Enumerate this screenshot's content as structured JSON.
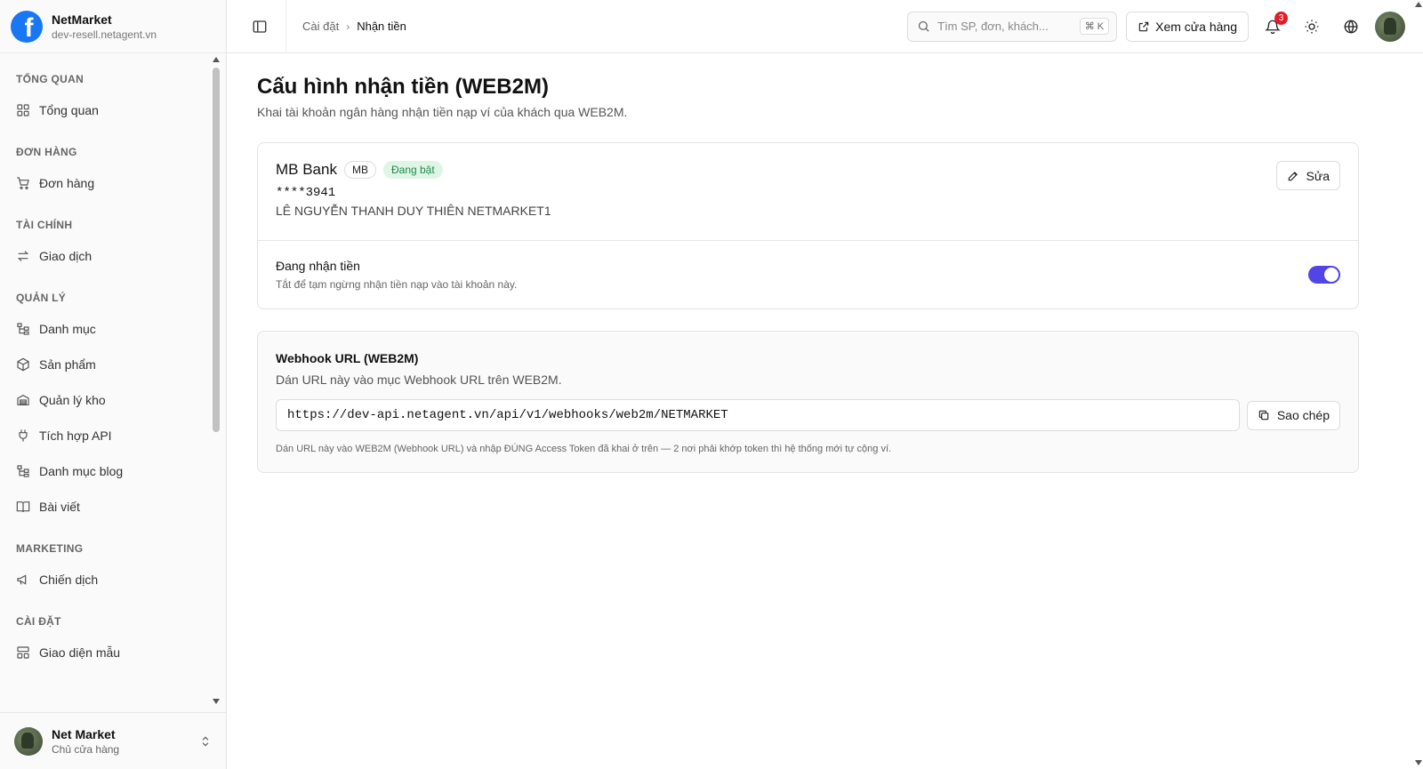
{
  "brand": {
    "name": "NetMarket",
    "domain": "dev-resell.netagent.vn",
    "logo_icon": "facebook-logo",
    "logo_glyph": "f"
  },
  "sidebar": {
    "sections": [
      {
        "title": "TỔNG QUAN",
        "items": [
          {
            "label": "Tổng quan",
            "icon": "dashboard-icon"
          }
        ]
      },
      {
        "title": "ĐƠN HÀNG",
        "items": [
          {
            "label": "Đơn hàng",
            "icon": "cart-icon"
          }
        ]
      },
      {
        "title": "TÀI CHÍNH",
        "items": [
          {
            "label": "Giao dịch",
            "icon": "transfer-icon"
          }
        ]
      },
      {
        "title": "QUẢN LÝ",
        "items": [
          {
            "label": "Danh mục",
            "icon": "category-tree-icon"
          },
          {
            "label": "Sản phẩm",
            "icon": "package-icon"
          },
          {
            "label": "Quản lý kho",
            "icon": "warehouse-icon"
          },
          {
            "label": "Tích hợp API",
            "icon": "plug-icon"
          },
          {
            "label": "Danh mục blog",
            "icon": "category-tree-icon"
          },
          {
            "label": "Bài viết",
            "icon": "book-icon"
          }
        ]
      },
      {
        "title": "MARKETING",
        "items": [
          {
            "label": "Chiến dịch",
            "icon": "megaphone-icon"
          }
        ]
      },
      {
        "title": "CÀI ĐẶT",
        "items": [
          {
            "label": "Giao diện mẫu",
            "icon": "layout-icon"
          }
        ]
      }
    ],
    "user": {
      "name": "Net Market",
      "role": "Chủ cửa hàng"
    }
  },
  "topbar": {
    "breadcrumb": {
      "parent": "Cài đặt",
      "current": "Nhận tiền",
      "separator": "›"
    },
    "search": {
      "placeholder": "Tìm SP, đơn, khách...",
      "shortcut": "⌘ K"
    },
    "store_button": "Xem cửa hàng",
    "notification_count": "3"
  },
  "page": {
    "title": "Cấu hình nhận tiền (WEB2M)",
    "subtitle": "Khai tài khoản ngân hàng nhận tiền nạp ví của khách qua WEB2M."
  },
  "bank_card": {
    "bank_name": "MB Bank",
    "bank_code": "MB",
    "status": "Đang bật",
    "account_number": "****3941",
    "account_holder": "LÊ NGUYỄN THANH DUY THIÊN NETMARKET1",
    "edit_label": "Sửa",
    "receiving_title": "Đang nhận tiền",
    "receiving_desc": "Tắt để tạm ngừng nhận tiền nạp vào tài khoản này.",
    "receiving_enabled": true
  },
  "webhook_card": {
    "title": "Webhook URL (WEB2M)",
    "subtitle": "Dán URL này vào mục Webhook URL trên WEB2M.",
    "url": "https://dev-api.netagent.vn/api/v1/webhooks/web2m/NETMARKET",
    "copy_label": "Sao chép",
    "note": "Dán URL này vào WEB2M (Webhook URL) và nhập ĐÚNG Access Token đã khai ở trên — 2 nơi phải khớp token thì hệ thống mới tự cộng ví."
  },
  "colors": {
    "accent": "#4f46e5",
    "status_bg": "#dff5e6",
    "status_text": "#1e8a4c",
    "badge": "#e11d2a",
    "brand": "#1877f2"
  }
}
